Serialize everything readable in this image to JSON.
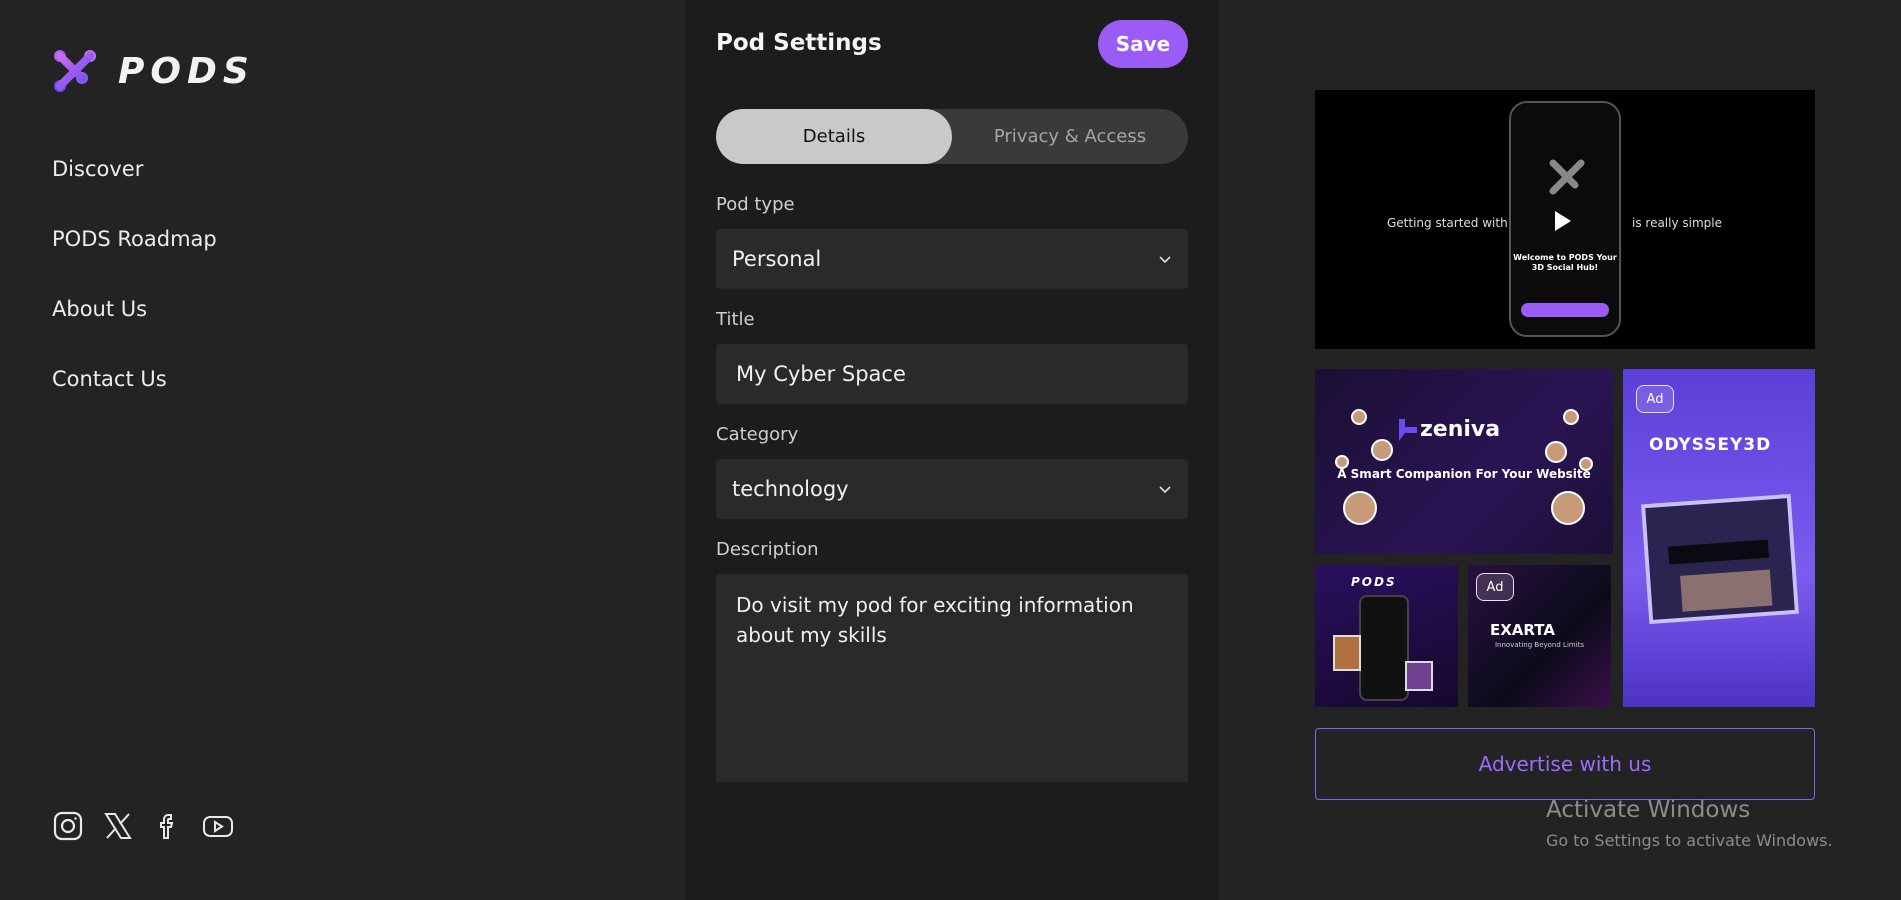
{
  "brand": {
    "logo_text": "PODS",
    "accent": "#9b5cf6"
  },
  "sidebar": {
    "nav": [
      {
        "label": "Discover"
      },
      {
        "label": "PODS Roadmap"
      },
      {
        "label": "About Us"
      },
      {
        "label": "Contact Us"
      }
    ],
    "socials": [
      "instagram-icon",
      "x-icon",
      "facebook-icon",
      "youtube-icon"
    ]
  },
  "panel": {
    "title": "Pod Settings",
    "save_label": "Save",
    "tabs": [
      {
        "label": "Details",
        "active": true
      },
      {
        "label": "Privacy & Access",
        "active": false
      }
    ],
    "pod_type": {
      "label": "Pod type",
      "value": "Personal"
    },
    "title_field": {
      "label": "Title",
      "value": "My Cyber Space"
    },
    "category": {
      "label": "Category",
      "value": "technology"
    },
    "description": {
      "label": "Description",
      "value": "Do visit my pod for exciting information about my skills"
    }
  },
  "promo": {
    "video_left": "Getting started with",
    "video_right": "is really simple",
    "phone_title": "Welcome to PODS Your 3D Social Hub!"
  },
  "ads": {
    "zeniva": {
      "brand": "zeniva",
      "tagline": "A Smart Companion For Your Website"
    },
    "odyssey": {
      "badge": "Ad",
      "brand": "ODYSSEY3D"
    },
    "pods_brand": "PODS",
    "exarta": {
      "badge": "Ad",
      "brand": "EXARTA",
      "tagline": "Innovating Beyond Limits"
    }
  },
  "advertise_label": "Advertise with us",
  "watermark": {
    "title": "Activate Windows",
    "subtitle": "Go to Settings to activate Windows."
  }
}
